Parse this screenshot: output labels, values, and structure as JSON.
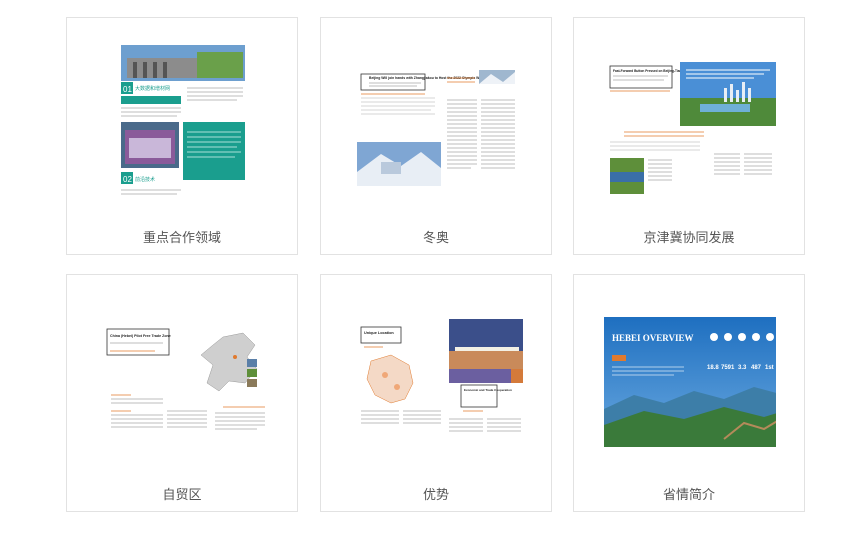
{
  "cards": [
    {
      "caption": "重点合作领域",
      "thumb": {
        "label_01": "01",
        "text_01": "大数据和增材网",
        "label_02": "02",
        "text_02": "前沿技术"
      }
    },
    {
      "caption": "冬奥",
      "thumb": {
        "headline": "Beijing Will join hands with Zhangjiakou to Host the 2022 Olympic Winter Games"
      }
    },
    {
      "caption": "京津冀协同发展",
      "thumb": {
        "headline": "Fast-Forward Button Pressed on Beijing-Tianjin-Hebei Coordinated Development"
      }
    },
    {
      "caption": "自贸区",
      "thumb": {
        "headline": "China (Hebei) Pilot Free Trade Zone"
      }
    },
    {
      "caption": "优势",
      "thumb": {
        "headline_1": "Unique Location",
        "headline_2": "Economic and Trade Cooperation"
      }
    },
    {
      "caption": "省情简介",
      "thumb": {
        "title": "HEBEI OVERVIEW",
        "stats": [
          "18.8",
          "7591",
          "3.3",
          "487",
          "1st"
        ]
      }
    }
  ],
  "colors": {
    "border": "#e2e2e2",
    "caption": "#555555",
    "teal": "#1a9e8e",
    "orange": "#e07a2e",
    "sky": "#2e7fc9"
  }
}
